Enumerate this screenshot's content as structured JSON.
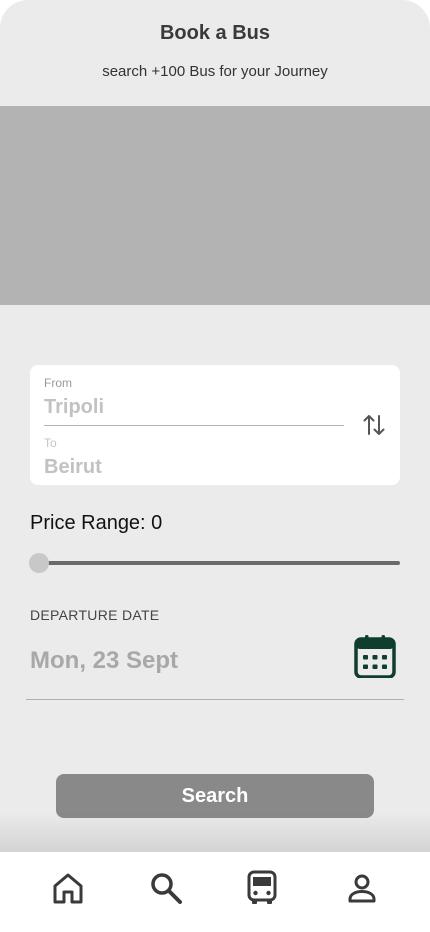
{
  "header": {
    "title": "Book a Bus",
    "subtitle": "search +100 Bus for your Journey"
  },
  "route": {
    "from_label": "From",
    "from_value": "Tripoli",
    "to_label": "To",
    "to_value": "Beirut",
    "swap_icon": "swap-vertical-icon"
  },
  "price": {
    "label": "Price Range: 0",
    "value": 0,
    "slider_fraction": 0
  },
  "departure": {
    "label": "DEPARTURE DATE",
    "value": "Mon, 23 Sept",
    "icon": "calendar-icon"
  },
  "search": {
    "label": "Search"
  },
  "nav": {
    "items": [
      {
        "icon": "home-icon"
      },
      {
        "icon": "search-icon"
      },
      {
        "icon": "bus-icon"
      },
      {
        "icon": "profile-icon"
      }
    ]
  },
  "colors": {
    "calendar_accent": "#0f3d2e",
    "button_bg": "#898989",
    "hero_placeholder": "#b3b3b3"
  }
}
